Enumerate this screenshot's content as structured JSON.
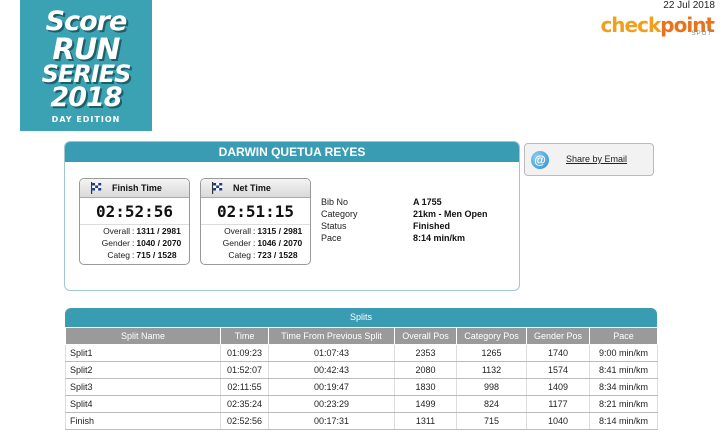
{
  "logo": {
    "line1": "Score",
    "line2": "RUN",
    "line3": "SERIES",
    "line4": "2018",
    "line5": "DAY EDITION"
  },
  "date": "22 Jul 2018",
  "brand": {
    "part1": "check",
    "part2": "point",
    "sub": "SPOT"
  },
  "athlete": {
    "name": "DARWIN QUETUA REYES",
    "finish": {
      "label": "Finish Time",
      "time": "02:52:56",
      "overall_label": "Overall",
      "overall": "1311 / 2981",
      "gender_label": "Gender",
      "gender": "1040 / 2070",
      "categ_label": "Categ",
      "categ": "715 / 1528"
    },
    "net": {
      "label": "Net Time",
      "time": "02:51:15",
      "overall_label": "Overall",
      "overall": "1315 / 2981",
      "gender_label": "Gender",
      "gender": "1046 / 2070",
      "categ_label": "Categ",
      "categ": "723 / 1528"
    },
    "info": [
      {
        "label": "Bib No",
        "value": "A 1755"
      },
      {
        "label": "Category",
        "value": "21km - Men Open"
      },
      {
        "label": "Status",
        "value": "Finished"
      },
      {
        "label": "Pace",
        "value": "8:14 min/km"
      }
    ]
  },
  "share": {
    "label": "Share by Email"
  },
  "splits": {
    "title": "Splits",
    "columns": [
      "Split Name",
      "Time",
      "Time From Previous Split",
      "Overall Pos",
      "Category Pos",
      "Gender Pos",
      "Pace"
    ],
    "rows": [
      [
        "Split1",
        "01:09:23",
        "01:07:43",
        "2353",
        "1265",
        "1740",
        "9:00 min/km"
      ],
      [
        "Split2",
        "01:52:07",
        "00:42:43",
        "2080",
        "1132",
        "1574",
        "8:41 min/km"
      ],
      [
        "Split3",
        "02:11:55",
        "00:19:47",
        "1830",
        "998",
        "1409",
        "8:34 min/km"
      ],
      [
        "Split4",
        "02:35:24",
        "00:23:29",
        "1499",
        "824",
        "1177",
        "8:21 min/km"
      ],
      [
        "Finish",
        "02:52:56",
        "00:17:31",
        "1311",
        "715",
        "1040",
        "8:14 min/km"
      ]
    ]
  }
}
